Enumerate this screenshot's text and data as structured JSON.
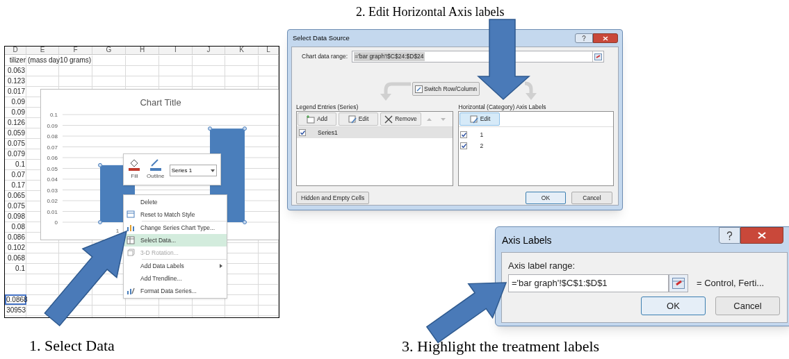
{
  "step_labels": [
    "1. Select Data",
    "2. Edit Horizontal Axis labels",
    "3. Highlight the treatment labels"
  ],
  "spreadsheet": {
    "columns": [
      "D",
      "E",
      "F",
      "G",
      "H",
      "I",
      "J",
      "K",
      "L"
    ],
    "header_cells": [
      "tilizer",
      "(mass day10 grams)"
    ],
    "column_d": [
      "0.063",
      "0.123",
      "0.017",
      "0.09",
      "0.09",
      "0.126",
      "0.059",
      "0.075",
      "0.079",
      "0.1",
      "0.07",
      "0.17",
      "0.065",
      "0.075",
      "0.098",
      "0.08",
      "0.086",
      "0.102",
      "0.068",
      "0.1"
    ],
    "lower_cells": [
      {
        "value": "0.0868",
        "selected": true
      },
      {
        "value": "30953",
        "selected": false
      }
    ]
  },
  "chart": {
    "title": "Chart Title",
    "series_selected": true,
    "chart_data": {
      "type": "bar",
      "grid": true,
      "categories": [
        "1",
        null
      ],
      "values": [
        0.053,
        0.087
      ],
      "ylim": [
        0,
        0.1
      ],
      "yticks": [
        0,
        0.01,
        0.02,
        0.03,
        0.04,
        0.05,
        0.06,
        0.07,
        0.08,
        0.09,
        0.1
      ]
    }
  },
  "mini_toolbar": {
    "fill_label": "Fill",
    "outline_label": "Outline",
    "series_value": "Series 1"
  },
  "context_menu": {
    "items": [
      {
        "label": "Delete",
        "kind": "item",
        "disabled": false,
        "selected": false,
        "separator_above": false
      },
      {
        "label": "Reset to Match Style",
        "kind": "item",
        "disabled": false,
        "selected": false,
        "separator_above": false
      },
      {
        "label": "Change Series Chart Type...",
        "kind": "item",
        "disabled": false,
        "selected": false,
        "separator_above": true
      },
      {
        "label": "Select Data...",
        "kind": "item",
        "disabled": false,
        "selected": true,
        "separator_above": false
      },
      {
        "label": "3-D Rotation...",
        "kind": "item",
        "disabled": true,
        "selected": false,
        "separator_above": false
      },
      {
        "label": "Add Data Labels",
        "kind": "submenu",
        "disabled": false,
        "selected": false,
        "separator_above": true
      },
      {
        "label": "Add Trendline...",
        "kind": "item",
        "disabled": false,
        "selected": false,
        "separator_above": false
      },
      {
        "label": "Format Data Series...",
        "kind": "item",
        "disabled": false,
        "selected": false,
        "separator_above": false
      }
    ]
  },
  "select_data_source": {
    "title": "Select Data Source",
    "range_label": "Chart data range:",
    "range_value": "='bar graph'!$C$24:$D$24",
    "switch_button": "Switch Row/Column",
    "legend": {
      "heading": "Legend Entries (Series)",
      "buttons": [
        "Add",
        "Edit",
        "Remove"
      ],
      "entries": [
        {
          "label": "Series1",
          "checked": true,
          "selected": true
        }
      ]
    },
    "axis": {
      "heading": "Horizontal (Category) Axis Labels",
      "edit_button": "Edit",
      "entries": [
        {
          "label": "1",
          "checked": true
        },
        {
          "label": "2",
          "checked": true
        }
      ]
    },
    "hidden_cells_button": "Hidden and Empty Cells",
    "ok": "OK",
    "cancel": "Cancel"
  },
  "axis_labels": {
    "title": "Axis Labels",
    "range_label": "Axis label range:",
    "range_value": "='bar graph'!$C$1:$D$1",
    "preview": "= Control, Ferti...",
    "ok": "OK",
    "cancel": "Cancel"
  }
}
